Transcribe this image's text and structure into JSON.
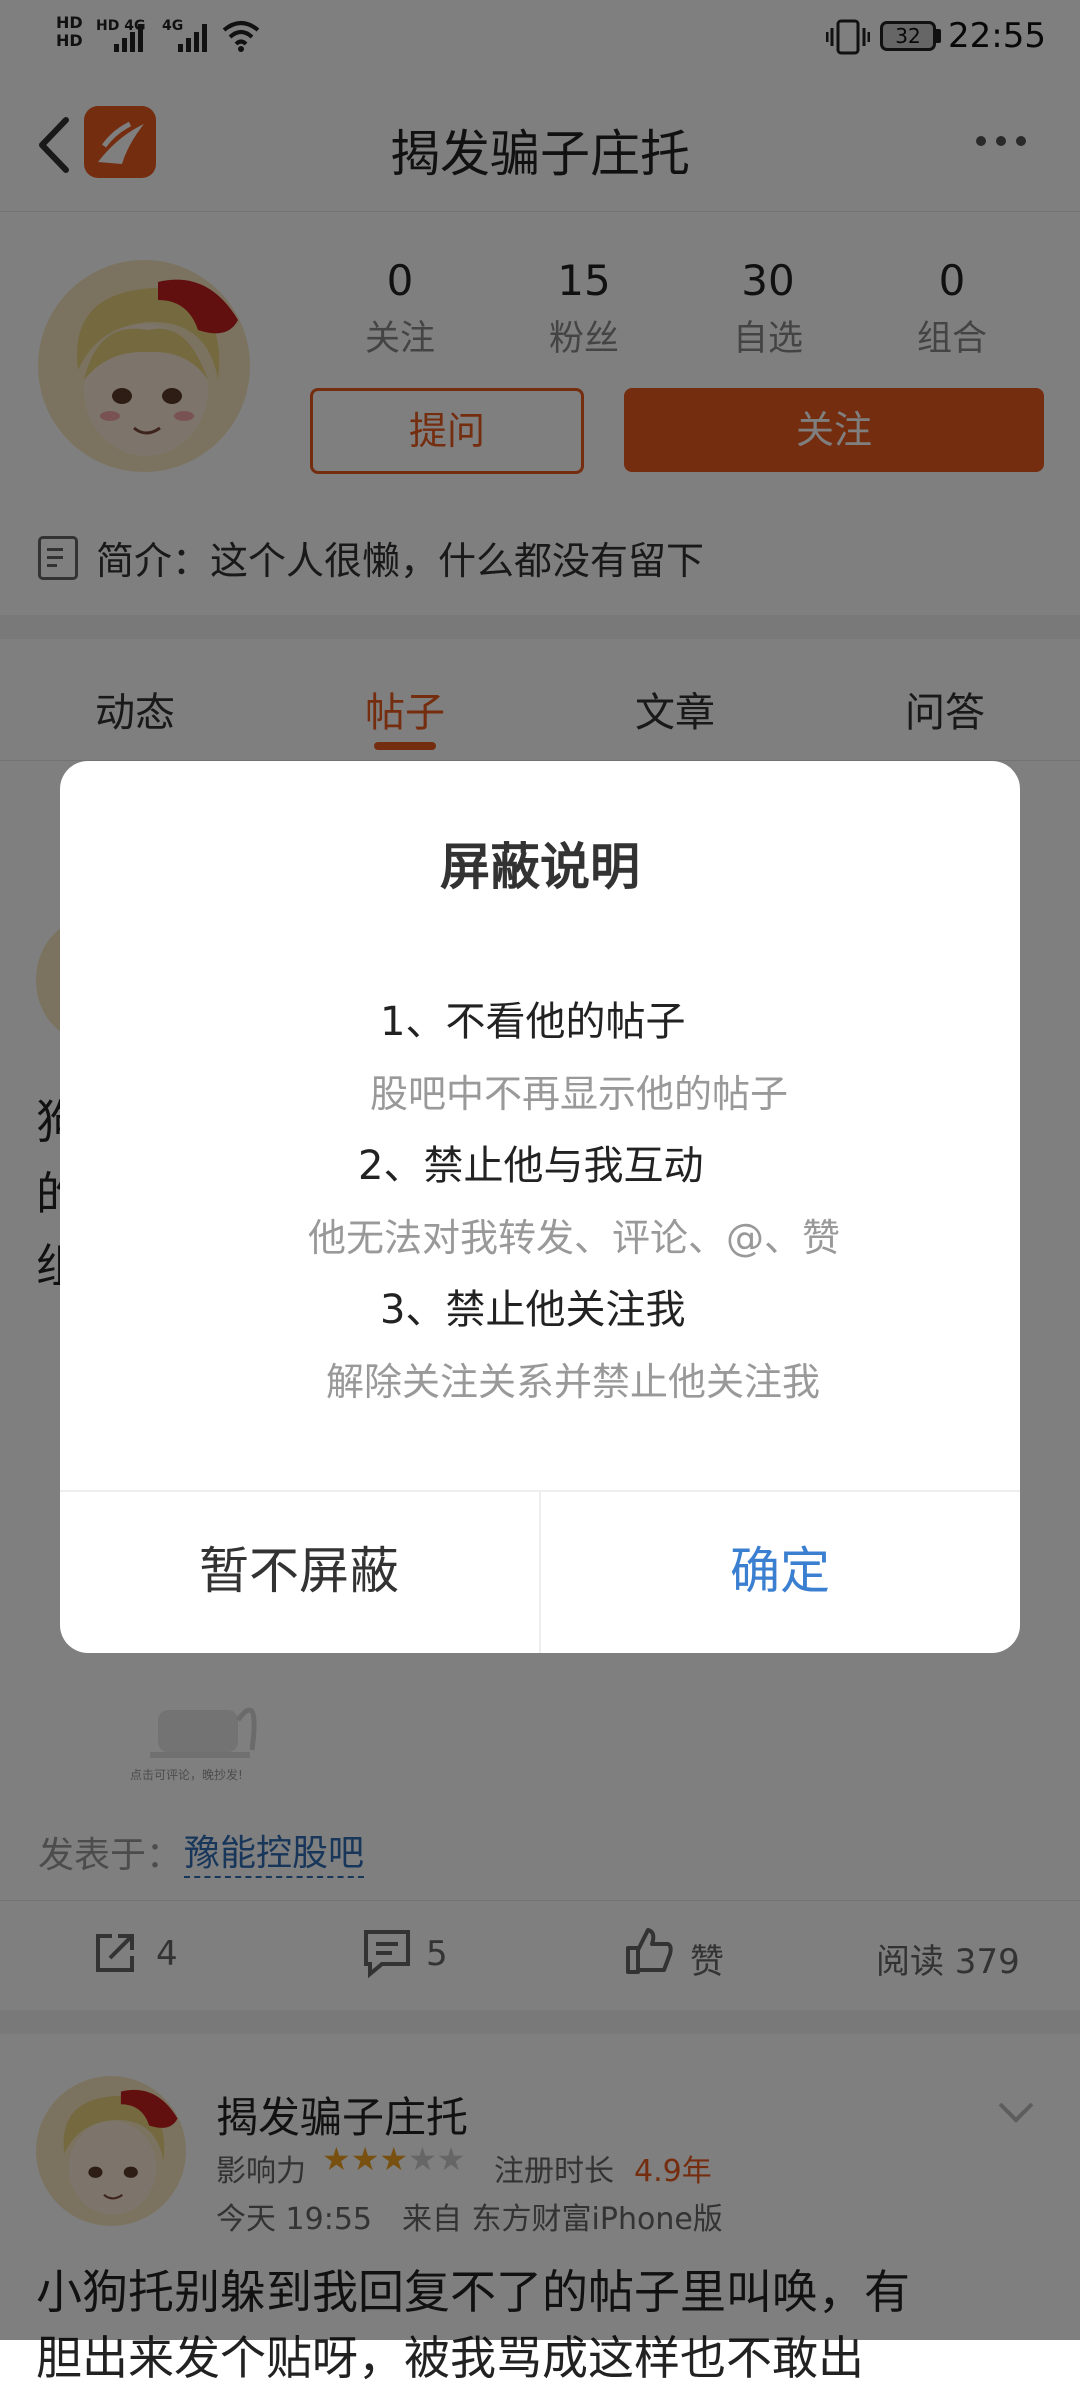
{
  "status_bar": {
    "network_left": "HD 4G",
    "network_right": "4G",
    "battery": "32",
    "time": "22:55"
  },
  "header": {
    "title": "揭发骗子庄托"
  },
  "profile": {
    "stats": [
      {
        "value": "0",
        "label": "关注"
      },
      {
        "value": "15",
        "label": "粉丝"
      },
      {
        "value": "30",
        "label": "自选"
      },
      {
        "value": "0",
        "label": "组合"
      }
    ],
    "ask_label": "提问",
    "follow_label": "关注",
    "bio": "简介：这个人很懒，什么都没有留下"
  },
  "tabs": [
    "动态",
    "帖子",
    "文章",
    "问答"
  ],
  "active_tab": 1,
  "feed": {
    "post1_lines": [
      "狗",
      "的",
      "组"
    ],
    "image_caption": "点击可评论，晚抄发!",
    "posted_in_label": "发表于：",
    "posted_in_bar": "豫能控股吧",
    "actions": {
      "share_count": "4",
      "comment_count": "5",
      "like_label": "赞",
      "read_label": "阅读 379"
    },
    "post2": {
      "author": "揭发骗子庄托",
      "influence_label": "影响力",
      "stars_filled": 3,
      "stars_total": 5,
      "reg_label": "注册时长",
      "reg_value": "4.9年",
      "time_source": "今天 19:55　来自 东方财富iPhone版",
      "text_line1": "小狗托别躲到我回复不了的帖子里叫唤，有",
      "text_line2": "胆出来发个贴呀，被我骂成这样也不敢出"
    }
  },
  "dialog": {
    "title": "屏蔽说明",
    "rules": [
      {
        "head": "1、不看他的帖子",
        "desc": "股吧中不再显示他的帖子"
      },
      {
        "head": "2、禁止他与我互动",
        "desc": "他无法对我转发、评论、@、赞"
      },
      {
        "head": "3、禁止他关注我",
        "desc": "解除关注关系并禁止他关注我"
      }
    ],
    "cancel_label": "暂不屏蔽",
    "confirm_label": "确定"
  },
  "colors": {
    "brand_orange": "#ea5a1f",
    "confirm_blue": "#3b7fd1",
    "link_blue": "#2e6db5"
  }
}
